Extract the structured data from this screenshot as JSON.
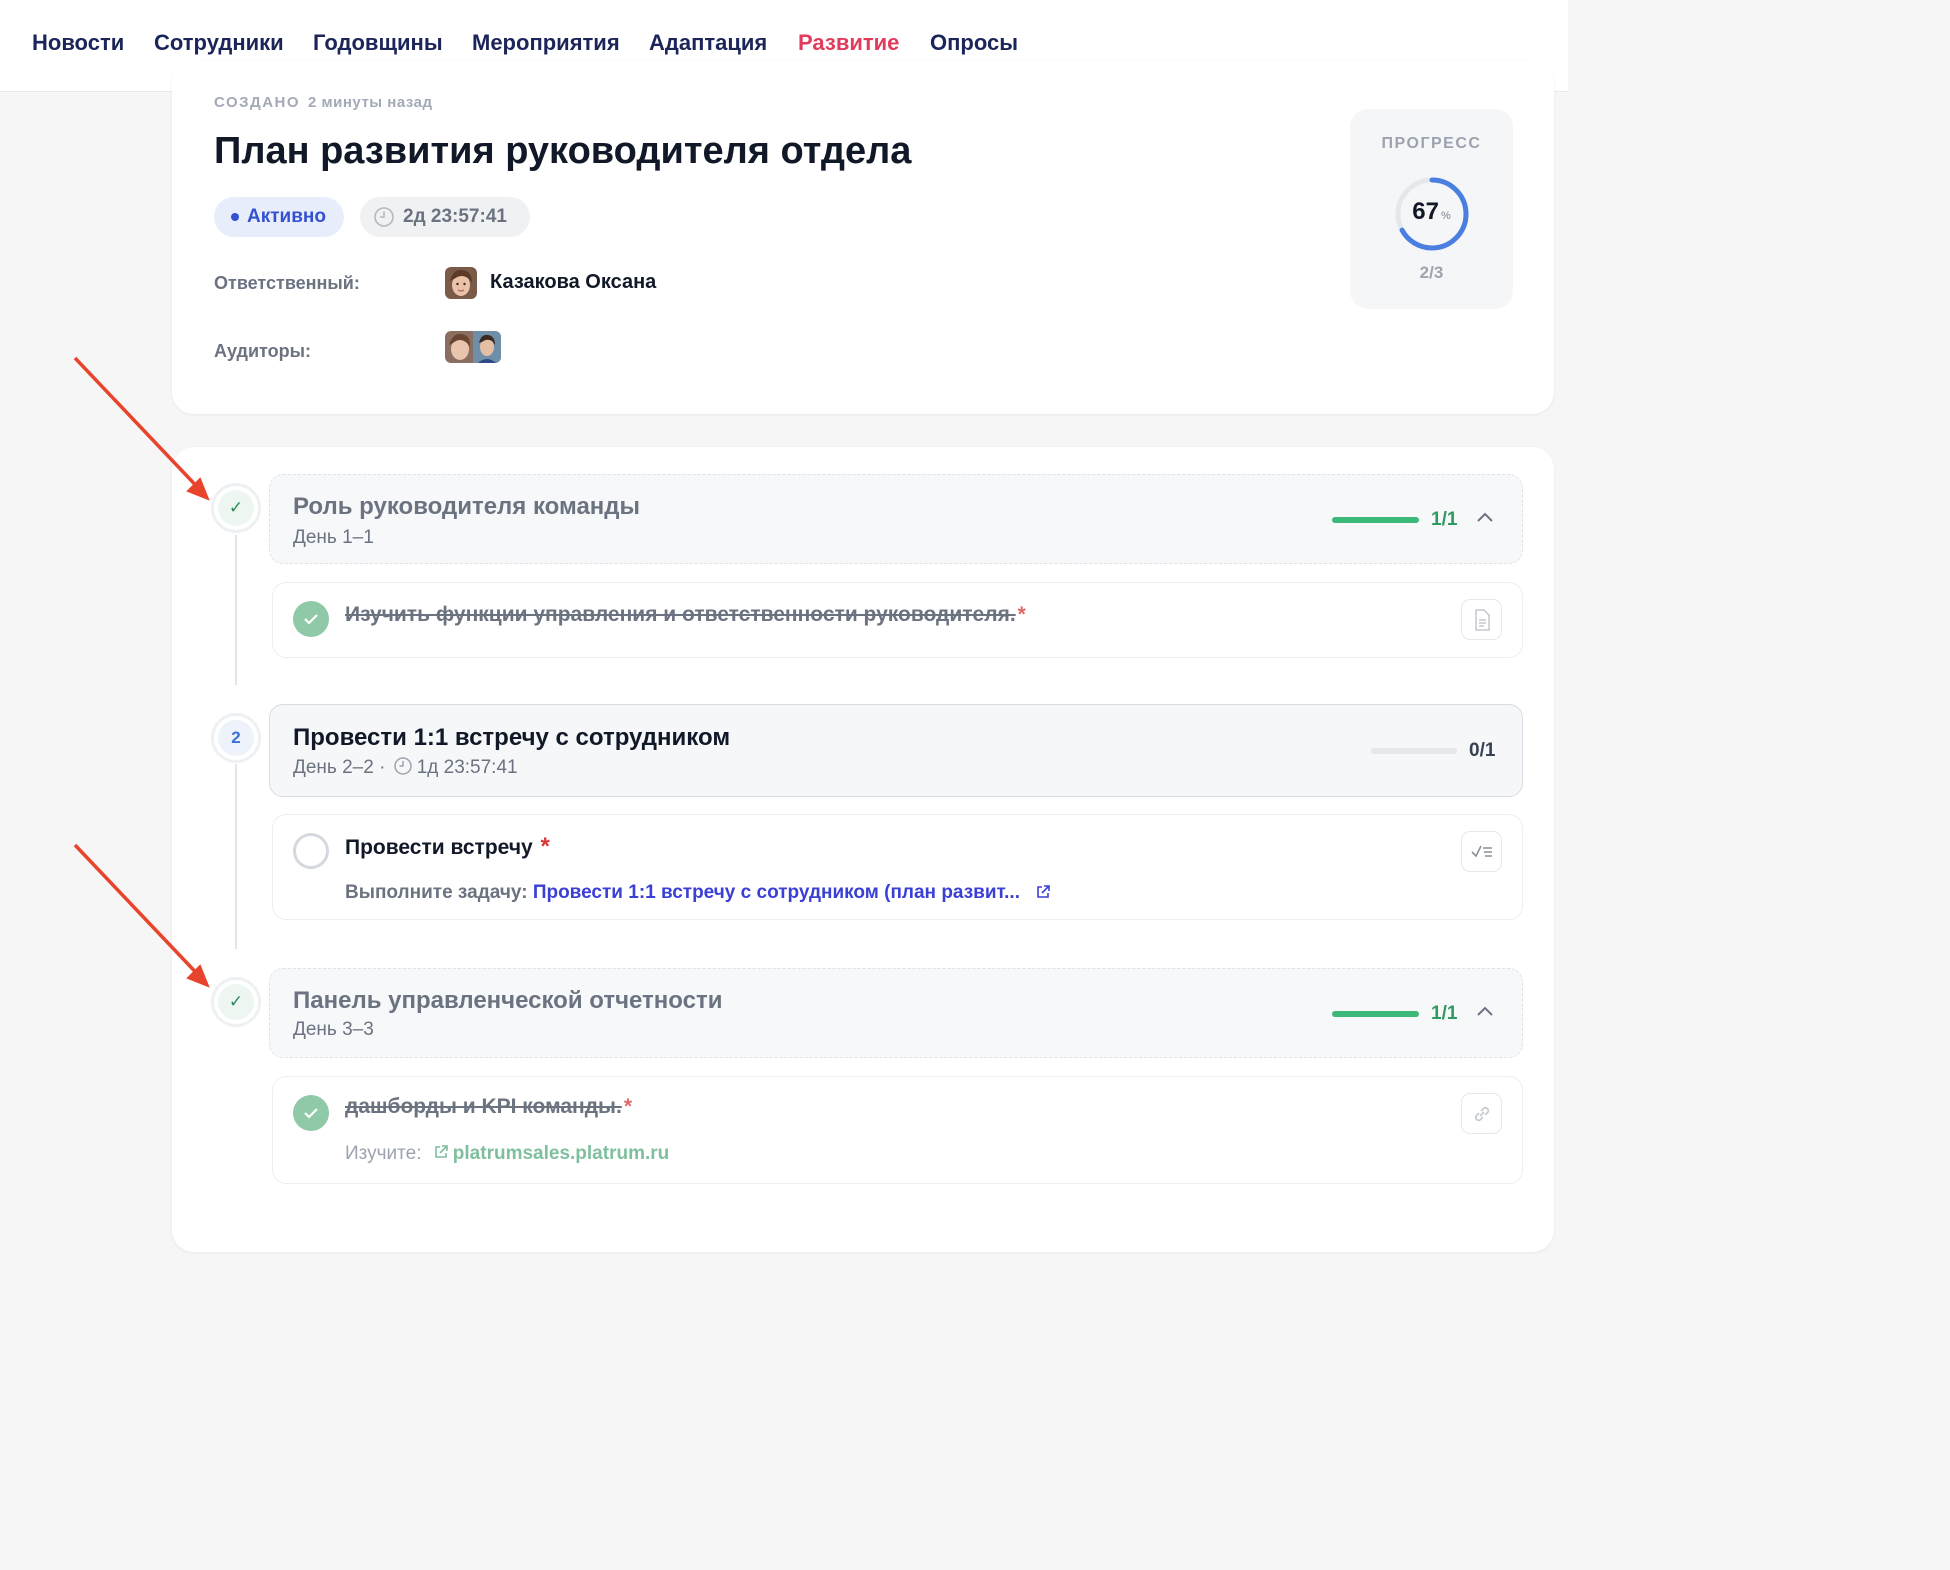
{
  "nav": {
    "tabs": [
      {
        "label": "Новости"
      },
      {
        "label": "Сотрудники"
      },
      {
        "label": "Годовщины"
      },
      {
        "label": "Мероприятия"
      },
      {
        "label": "Адаптация"
      },
      {
        "label": "Развитие",
        "active": true
      },
      {
        "label": "Опросы"
      }
    ]
  },
  "plan": {
    "created_label": "СОЗДАНО",
    "created_ago": "2 минуты назад",
    "title": "План развития руководителя отдела",
    "status": "Активно",
    "timer": "2д 23:57:41",
    "owner_label": "Ответственный:",
    "owner_name": "Казакова Оксана",
    "auditors_label": "Аудиторы:"
  },
  "progress": {
    "label": "ПРОГРЕСС",
    "percent": "67",
    "percent_sign": "%",
    "percent_value": 67,
    "count": "2/3"
  },
  "steps": [
    {
      "marker": "✓",
      "title": "Роль руководителя команды",
      "subtitle": "День 1–1",
      "count": "1/1",
      "done": true,
      "progress_value": 1.0,
      "tasks": [
        {
          "title": "Изучить функции управления и ответственности руководителя.",
          "required": "*",
          "done": true,
          "type_icon": "document-icon"
        }
      ]
    },
    {
      "marker": "2",
      "title": "Провести 1:1 встречу с сотрудником",
      "subtitle": "День 2–2 ·",
      "timer": "1д 23:57:41",
      "count": "0/1",
      "done": false,
      "progress_value": 0.0,
      "tasks": [
        {
          "title": "Провести встречу",
          "required": "*",
          "done": false,
          "type_icon": "checklist-icon",
          "meta_label": "Выполните задачу:",
          "meta_link": "Провести 1:1 встречу с сотрудником (план развит..."
        }
      ]
    },
    {
      "marker": "✓",
      "title": "Панель управленческой отчетности",
      "subtitle": "День 3–3",
      "count": "1/1",
      "done": true,
      "progress_value": 1.0,
      "tasks": [
        {
          "title": "дашборды и KPI команды.",
          "required": "*",
          "done": true,
          "type_icon": "link-icon",
          "meta_label": "Изучите:",
          "meta_link": "platrumsales.platrum.ru"
        }
      ]
    }
  ],
  "colors": {
    "nav_text": "#1b2559",
    "nav_active": "#e23b5c",
    "progress_ring": "#4a7fe0",
    "done_green": "#3cb878",
    "link_blue": "#3a3fd6",
    "arrow_red": "#e8432c"
  }
}
